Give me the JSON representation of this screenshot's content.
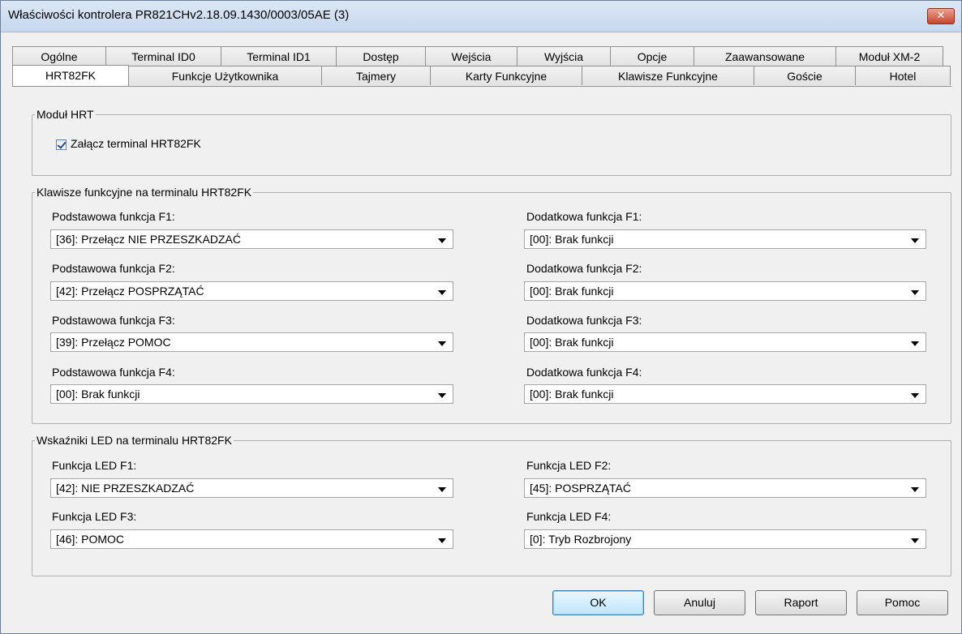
{
  "window": {
    "title": "Właściwości kontrolera PR821CHv2.18.09.1430/0003/05AE (3)",
    "close_label": "✕"
  },
  "tabs_row1": [
    "Ogólne",
    "Terminal ID0",
    "Terminal ID1",
    "Dostęp",
    "Wejścia",
    "Wyjścia",
    "Opcje",
    "Zaawansowane",
    "Moduł XM-2"
  ],
  "tabs_row2": [
    "HRT82FK",
    "Funkcje Użytkownika",
    "Tajmery",
    "Karty Funkcyjne",
    "Klawisze Funkcyjne",
    "Goście",
    "Hotel"
  ],
  "active_tab": "HRT82FK",
  "hrt_module": {
    "legend": "Moduł HRT",
    "enable_label": "Załącz terminal HRT82FK",
    "enable_checked": true
  },
  "function_keys": {
    "legend": "Klawisze funkcyjne na terminalu HRT82FK",
    "basic": [
      {
        "label": "Podstawowa funkcja F1:",
        "value": "[36]: Przełącz NIE PRZESZKADZAĆ"
      },
      {
        "label": "Podstawowa funkcja F2:",
        "value": "[42]: Przełącz POSPRZĄTAĆ"
      },
      {
        "label": "Podstawowa funkcja F3:",
        "value": "[39]: Przełącz POMOC"
      },
      {
        "label": "Podstawowa funkcja F4:",
        "value": "[00]: Brak funkcji"
      }
    ],
    "extra": [
      {
        "label": "Dodatkowa funkcja F1:",
        "value": "[00]: Brak funkcji"
      },
      {
        "label": "Dodatkowa funkcja F2:",
        "value": "[00]: Brak funkcji"
      },
      {
        "label": "Dodatkowa funkcja F3:",
        "value": "[00]: Brak funkcji"
      },
      {
        "label": "Dodatkowa funkcja F4:",
        "value": "[00]: Brak funkcji"
      }
    ]
  },
  "led": {
    "legend": "Wskaźniki LED na terminalu HRT82FK",
    "items": [
      {
        "label": "Funkcja LED F1:",
        "value": "[42]: NIE PRZESZKADZAĆ"
      },
      {
        "label": "Funkcja LED F2:",
        "value": "[45]: POSPRZĄTAĆ"
      },
      {
        "label": "Funkcja LED F3:",
        "value": "[46]: POMOC"
      },
      {
        "label": "Funkcja LED F4:",
        "value": "[0]: Tryb Rozbrojony"
      }
    ]
  },
  "buttons": {
    "ok": "OK",
    "cancel": "Anuluj",
    "report": "Raport",
    "help": "Pomoc"
  }
}
